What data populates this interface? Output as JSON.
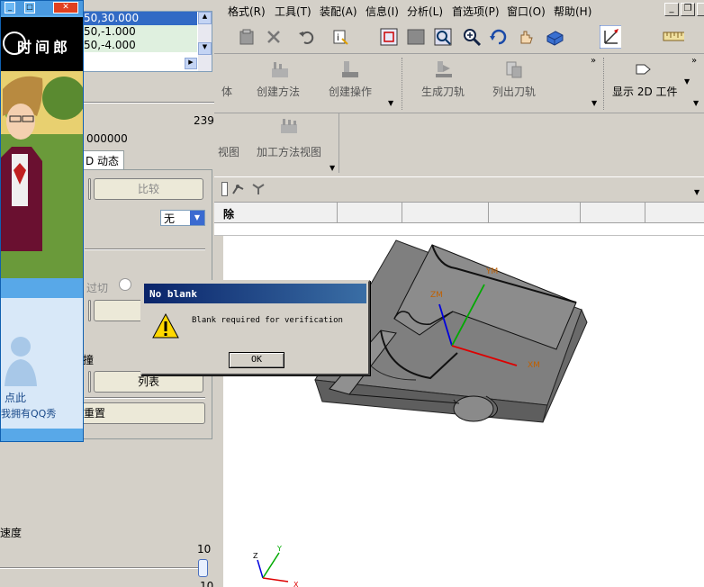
{
  "menu": {
    "items": [
      "格式(R)",
      "工具(T)",
      "装配(A)",
      "信息(I)",
      "分析(L)",
      "首选项(P)",
      "窗口(O)",
      "帮助(H)"
    ]
  },
  "ribbon": {
    "group1": [
      "体",
      "创建方法",
      "创建操作"
    ],
    "group2": [
      "生成刀轨",
      "列出刀轨"
    ],
    "display": "显示 2D 工件",
    "row2": [
      "视图",
      "加工方法视图"
    ]
  },
  "navigator": {
    "header": "除"
  },
  "left_panel": {
    "list_items": [
      "50,30.000",
      "50,-1.000",
      "50,-4.000"
    ],
    "value_239": "239",
    "value_decimal": "000000",
    "tab_label": "D 动态",
    "compare_button": "比较",
    "dropdown_value": "无",
    "radio_label": "过切",
    "collision_label": "撞",
    "list_button": "列表",
    "reset_button": "重置",
    "speed_label": "速度",
    "slider_max_top": "10",
    "slider_max_bottom": "10"
  },
  "qq": {
    "brand": "时间郎",
    "click_text": "点此",
    "promo_text": "我拥有QQ秀"
  },
  "dialog": {
    "title": "No blank",
    "message": "Blank required for verification",
    "ok_label": "OK"
  },
  "viewport": {
    "wcs_labels": [
      "ZM",
      "XM",
      "YM"
    ],
    "axis_labels": {
      "z": "Z",
      "y": "Y",
      "x": "X"
    }
  },
  "colors": {
    "title_bar": "#0a246a",
    "model_gray": "#7a7a7a",
    "qq_blue": "#58a8e8"
  }
}
